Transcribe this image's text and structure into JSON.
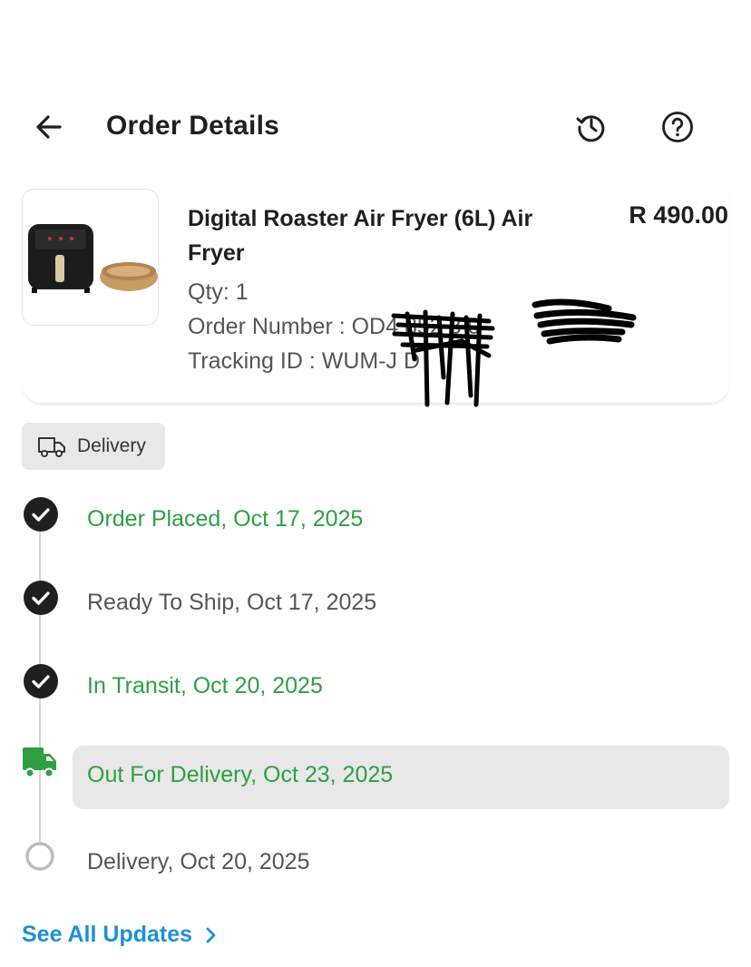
{
  "header": {
    "title": "Order Details",
    "back_icon": "arrow-left-icon",
    "history_icon": "history-icon",
    "help_icon": "help-icon"
  },
  "product": {
    "name": "Digital Roaster Air Fryer (6L) Air Fryer",
    "price": "R 490.00",
    "qty": "Qty: 1",
    "order_number": "Order Number : OD4  852 3  0",
    "tracking_id": "Tracking ID : WUM-J   D",
    "image_icon": "air-fryer-image"
  },
  "delivery_chip": {
    "label": "Delivery",
    "icon": "truck-icon"
  },
  "timeline": [
    {
      "label": "Order Placed, Oct 17, 2025",
      "status": "done",
      "color": "#2ea043"
    },
    {
      "label": "Ready To Ship, Oct 17, 2025",
      "status": "done",
      "color": "#555555"
    },
    {
      "label": "In Transit, Oct 20, 2025",
      "status": "done",
      "color": "#2ea043"
    },
    {
      "label": "Out For Delivery, Oct 23, 2025",
      "status": "current",
      "color": "#2ea043"
    },
    {
      "label": "Delivery, Oct 20, 2025",
      "status": "pending",
      "color": "#555555"
    }
  ],
  "see_all": {
    "label": "See All Updates",
    "icon": "chevron-right-icon"
  },
  "colors": {
    "accent_green": "#2ea043",
    "link_blue": "#1e90d6",
    "chip_bg": "#e8e8e8"
  }
}
